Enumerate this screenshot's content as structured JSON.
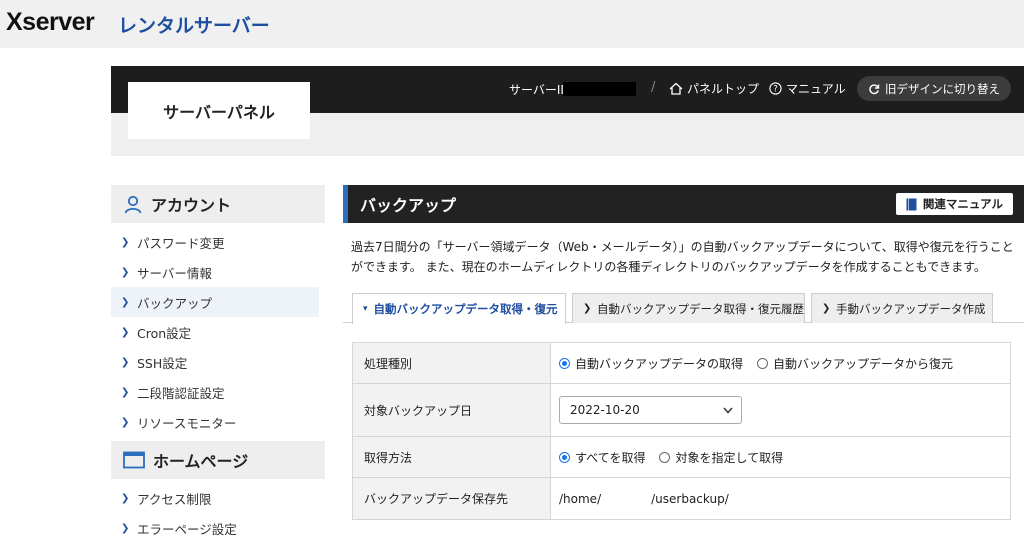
{
  "brand": {
    "logo": "Xserver",
    "sub": "レンタルサーバー"
  },
  "panel": {
    "title": "サーバーパネル"
  },
  "header": {
    "server_id_label": "サーバーID",
    "separator": "/",
    "panel_top": "パネルトップ",
    "manual": "マニュアル",
    "old_design": "旧デザインに切り替え"
  },
  "sidebar": {
    "account": {
      "title": "アカウント",
      "items": [
        {
          "label": "パスワード変更"
        },
        {
          "label": "サーバー情報"
        },
        {
          "label": "バックアップ"
        },
        {
          "label": "Cron設定"
        },
        {
          "label": "SSH設定"
        },
        {
          "label": "二段階認証設定"
        },
        {
          "label": "リソースモニター"
        }
      ]
    },
    "homepage": {
      "title": "ホームページ",
      "items": [
        {
          "label": "アクセス制限"
        },
        {
          "label": "エラーページ設定"
        }
      ]
    }
  },
  "main": {
    "title": "バックアップ",
    "manual_button": "関連マニュアル",
    "description_line1": "過去7日間分の「サーバー領域データ（Web・メールデータ）」の自動バックアップデータについて、取得や復元を行うこと",
    "description_line2": "ができます。 また、現在のホームディレクトリの各種ディレクトリのバックアップデータを作成することもできます。",
    "tabs": [
      {
        "label": "自動バックアップデータ取得・復元"
      },
      {
        "label": "自動バックアップデータ取得・復元履歴"
      },
      {
        "label": "手動バックアップデータ作成"
      }
    ],
    "form": {
      "type_label": "処理種別",
      "type_opt1": "自動バックアップデータの取得",
      "type_opt2": "自動バックアップデータから復元",
      "date_label": "対象バックアップ日",
      "date_value": "2022-10-20",
      "method_label": "取得方法",
      "method_opt1": "すべてを取得",
      "method_opt2": "対象を指定して取得",
      "dest_label": "バックアップデータ保存先",
      "dest_prefix": "/home/",
      "dest_suffix": "/userbackup/"
    }
  }
}
